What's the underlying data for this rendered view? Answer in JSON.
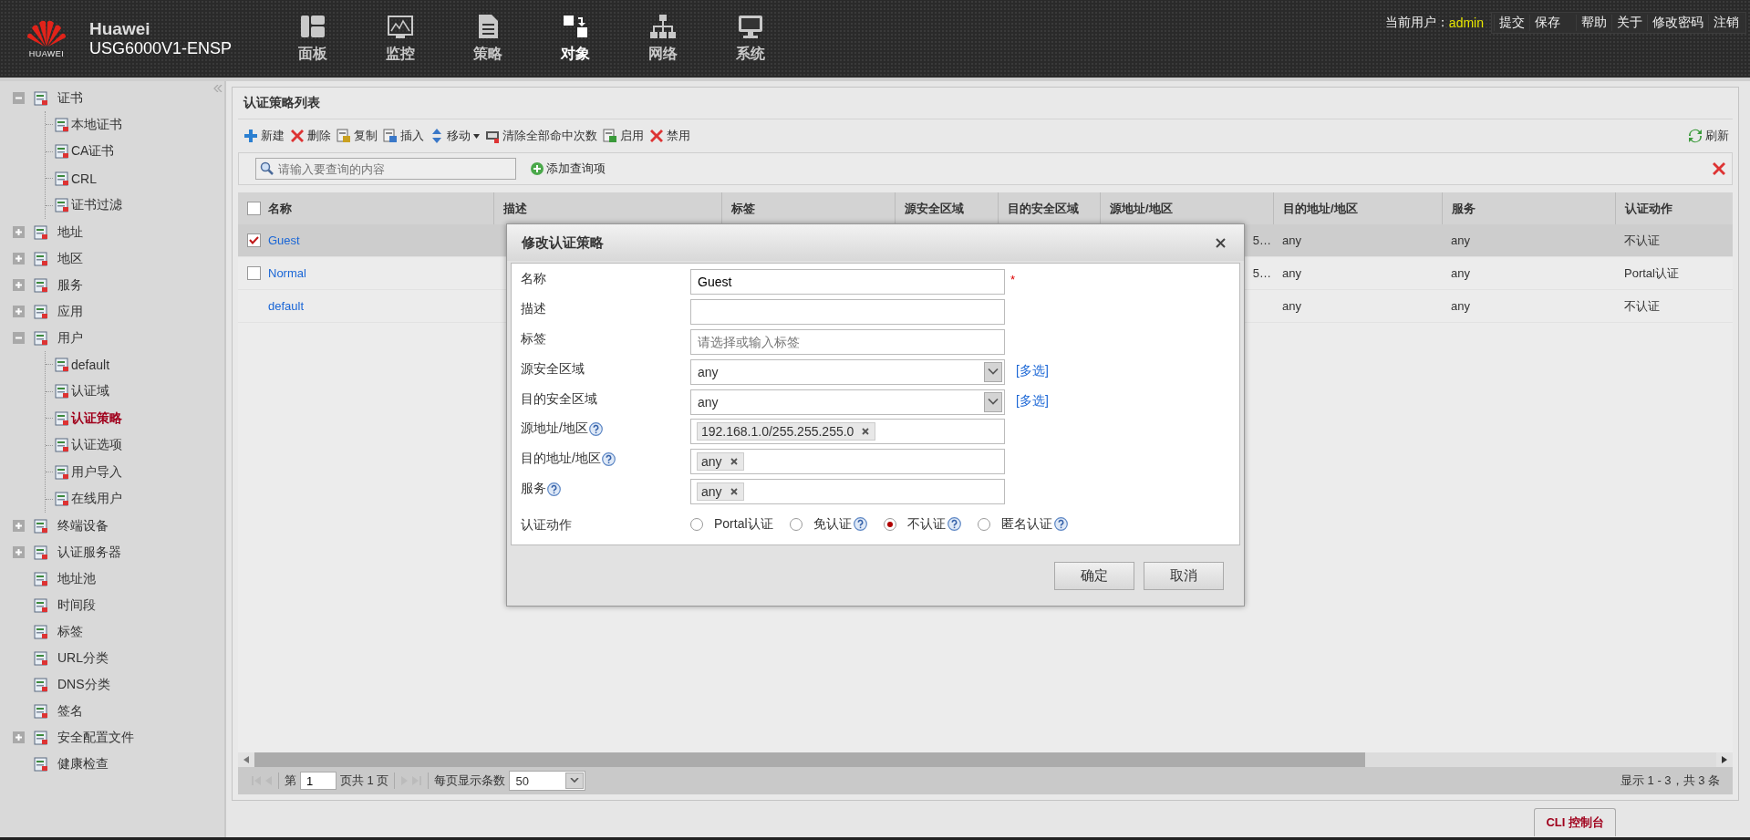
{
  "header": {
    "logo_text": "HUAWEI",
    "brand": "Huawei",
    "model": "USG6000V1-ENSP",
    "nav": [
      {
        "label": "面板",
        "selected": false
      },
      {
        "label": "监控",
        "selected": false
      },
      {
        "label": "策略",
        "selected": false
      },
      {
        "label": "对象",
        "selected": true
      },
      {
        "label": "网络",
        "selected": false
      },
      {
        "label": "系统",
        "selected": false
      }
    ],
    "user_label": "当前用户：",
    "user": "admin",
    "links": [
      "提交",
      "保存",
      "帮助",
      "关于",
      "修改密码",
      "注销"
    ]
  },
  "sidebar": {
    "items": [
      {
        "label": "证书",
        "expanded": true,
        "selected": false,
        "children": [
          {
            "label": "本地证书",
            "selected": false
          },
          {
            "label": "CA证书",
            "selected": false
          },
          {
            "label": "CRL",
            "selected": false
          },
          {
            "label": "证书过滤",
            "selected": false
          }
        ]
      },
      {
        "label": "地址",
        "expanded": false,
        "selected": false
      },
      {
        "label": "地区",
        "expanded": false,
        "selected": false
      },
      {
        "label": "服务",
        "expanded": false,
        "selected": false
      },
      {
        "label": "应用",
        "expanded": false,
        "selected": false
      },
      {
        "label": "用户",
        "expanded": true,
        "selected": false,
        "children": [
          {
            "label": "default",
            "selected": false
          },
          {
            "label": "认证域",
            "selected": false
          },
          {
            "label": "认证策略",
            "selected": true
          },
          {
            "label": "认证选项",
            "selected": false
          },
          {
            "label": "用户导入",
            "selected": false
          },
          {
            "label": "在线用户",
            "selected": false
          }
        ]
      },
      {
        "label": "终端设备",
        "expanded": false,
        "selected": false
      },
      {
        "label": "认证服务器",
        "expanded": false,
        "selected": false
      },
      {
        "label": "地址池",
        "selected": false
      },
      {
        "label": "时间段",
        "selected": false
      },
      {
        "label": "标签",
        "selected": false
      },
      {
        "label": "URL分类",
        "selected": false
      },
      {
        "label": "DNS分类",
        "selected": false
      },
      {
        "label": "签名",
        "selected": false
      },
      {
        "label": "安全配置文件",
        "expanded": false,
        "selected": false
      },
      {
        "label": "健康检查",
        "selected": false
      }
    ]
  },
  "panel": {
    "title": "认证策略列表",
    "tools": [
      "新建",
      "删除",
      "复制",
      "插入",
      "移动",
      "清除全部命中次数",
      "启用",
      "禁用"
    ],
    "refresh": "刷新",
    "search": {
      "placeholder": "请输入要查询的内容"
    },
    "add_query": "添加查询项",
    "table": {
      "all_checked": false,
      "columns": [
        "名称",
        "描述",
        "标签",
        "源安全区域",
        "目的安全区域",
        "源地址/地区",
        "目的地址/地区",
        "服务",
        "认证动作"
      ],
      "rows": [
        {
          "kind": "policy",
          "checked": true,
          "selected": true,
          "name": "Guest",
          "source_address": "5…",
          "destination_address": "any",
          "service": "any",
          "action": "不认证"
        },
        {
          "kind": "policy",
          "checked": false,
          "selected": false,
          "name": "Normal",
          "source_address": "5…",
          "destination_address": "any",
          "service": "any",
          "action": "Portal认证"
        },
        {
          "kind": "default",
          "selected": false,
          "name": "default",
          "destination_address": "any",
          "service": "any",
          "action": "不认证"
        }
      ]
    },
    "pager": {
      "page_prefix": "第",
      "page": "1",
      "page_suffix": "页共 1 页",
      "per_page_label": "每页显示条数",
      "per_page": "50",
      "summary": "显示 1 - 3，共 3 条"
    }
  },
  "cli_tab": "CLI 控制台",
  "dialog": {
    "title": "修改认证策略",
    "required_mark": "*",
    "fields": [
      {
        "label": "名称",
        "kind": "text",
        "value": "Guest",
        "required": true,
        "help": false
      },
      {
        "label": "描述",
        "kind": "text",
        "required": false,
        "help": false
      },
      {
        "label": "标签",
        "kind": "text",
        "placeholder": "请选择或输入标签",
        "required": false,
        "help": false
      },
      {
        "label": "源安全区域",
        "kind": "select",
        "value": "any",
        "link": "[多选]",
        "required": false,
        "help": false
      },
      {
        "label": "目的安全区域",
        "kind": "select",
        "value": "any",
        "link": "[多选]",
        "required": false,
        "help": false
      },
      {
        "label": "源地址/地区",
        "kind": "tags",
        "tags": [
          "192.168.1.0/255.255.255.0"
        ],
        "required": false,
        "help": true
      },
      {
        "label": "目的地址/地区",
        "kind": "tags",
        "tags": [
          "any"
        ],
        "required": false,
        "help": true
      },
      {
        "label": "服务",
        "kind": "tags",
        "tags": [
          "any"
        ],
        "required": false,
        "help": true
      },
      {
        "label": "认证动作",
        "kind": "radio",
        "required": false,
        "help": false,
        "options": [
          {
            "label": "Portal认证",
            "selected": false,
            "help": false
          },
          {
            "label": "免认证",
            "selected": false,
            "help": true
          },
          {
            "label": "不认证",
            "selected": true,
            "help": true
          },
          {
            "label": "匿名认证",
            "selected": false,
            "help": true
          }
        ]
      }
    ],
    "buttons": [
      "确定",
      "取消"
    ]
  }
}
